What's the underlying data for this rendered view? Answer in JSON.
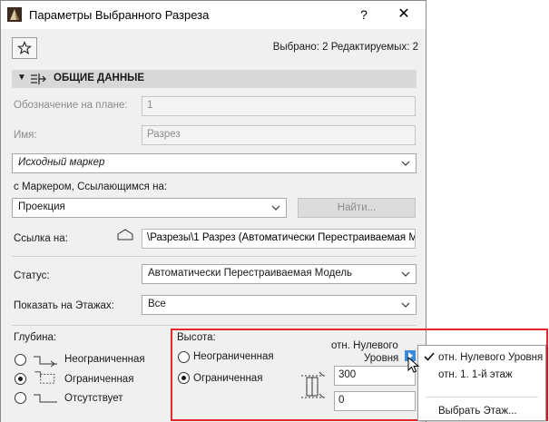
{
  "window": {
    "title": "Параметры Выбранного Разреза",
    "help": "?",
    "close": "✕"
  },
  "selection_info": "Выбрано: 2 Редактируемых: 2",
  "section": {
    "title": "ОБЩИЕ ДАННЫЕ"
  },
  "fields": {
    "plan_id_label": "Обозначение на плане:",
    "plan_id_value": "1",
    "name_label": "Имя:",
    "name_value": "Разрез",
    "marker_select": "Исходный маркер",
    "referring_label": "с Маркером, Ссылающимся на:",
    "referring_select": "Проекция",
    "find_button": "Найти...",
    "link_label": "Ссылка на:",
    "link_value": "\\Разрезы\\1 Разрез (Автоматически Перестраиваемая М",
    "status_label": "Статус:",
    "status_select": "Автоматически Перестраиваемая Модель",
    "show_on_stories_label": "Показать на Этажах:",
    "show_on_stories_select": "Все"
  },
  "depth": {
    "label": "Глубина:",
    "options": [
      "Неограниченная",
      "Ограниченная",
      "Отсутствует"
    ],
    "selected": "Ограниченная"
  },
  "height": {
    "label": "Высота:",
    "options": [
      "Неограниченная",
      "Ограниченная"
    ],
    "selected": "Ограниченная",
    "reference_line1": "отн. Нулевого",
    "reference_line2": "Уровня",
    "top_value": "300",
    "bottom_value": "0"
  },
  "popup_menu": {
    "items": [
      "отн. Нулевого Уровня",
      "отн. 1. 1-й этаж",
      "Выбрать Этаж..."
    ],
    "checked": "отн. Нулевого Уровня"
  },
  "colors": {
    "highlight": "#e8262b",
    "arrow_button": "#3a8ad8"
  }
}
